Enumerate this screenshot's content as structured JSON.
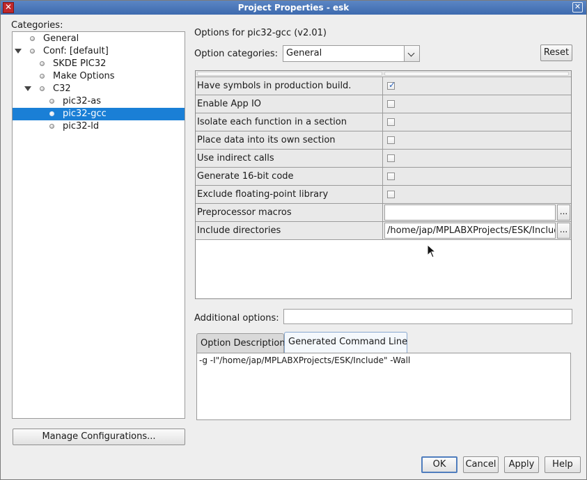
{
  "window": {
    "title": "Project Properties - esk",
    "app_icon_glyph": "✕",
    "close_glyph": "✕"
  },
  "categories": {
    "label": "Categories:",
    "items": [
      {
        "label": "General",
        "level": 0,
        "expanded": false,
        "selected": false
      },
      {
        "label": "Conf: [default]",
        "level": 0,
        "expanded": true,
        "selected": false
      },
      {
        "label": "SKDE PIC32",
        "level": 1,
        "expanded": false,
        "selected": false
      },
      {
        "label": "Make Options",
        "level": 1,
        "expanded": false,
        "selected": false
      },
      {
        "label": "C32",
        "level": 1,
        "expanded": true,
        "selected": false
      },
      {
        "label": "pic32-as",
        "level": 2,
        "expanded": false,
        "selected": false
      },
      {
        "label": "pic32-gcc",
        "level": 2,
        "expanded": false,
        "selected": true
      },
      {
        "label": "pic32-ld",
        "level": 2,
        "expanded": false,
        "selected": false
      }
    ]
  },
  "manage_button": "Manage Configurations...",
  "options": {
    "header": "Options for pic32-gcc (v2.01)",
    "categories_label": "Option categories:",
    "selected_category": "General",
    "reset_button": "Reset",
    "rows": [
      {
        "name": "Have symbols in production build.",
        "type": "checkbox",
        "checked": true
      },
      {
        "name": "Enable App IO",
        "type": "checkbox",
        "checked": false
      },
      {
        "name": "Isolate each function in a section",
        "type": "checkbox",
        "checked": false
      },
      {
        "name": "Place data into its own section",
        "type": "checkbox",
        "checked": false
      },
      {
        "name": "Use indirect calls",
        "type": "checkbox",
        "checked": false
      },
      {
        "name": "Generate 16-bit code",
        "type": "checkbox",
        "checked": false
      },
      {
        "name": "Exclude floating-point library",
        "type": "checkbox",
        "checked": false
      },
      {
        "name": "Preprocessor macros",
        "type": "text",
        "value": ""
      },
      {
        "name": "Include directories",
        "type": "text",
        "value": "/home/jap/MPLABXProjects/ESK/Include"
      }
    ],
    "ellipsis_label": "...",
    "additional_label": "Additional options:",
    "additional_value": ""
  },
  "tabs": {
    "option_description": "Option Description",
    "generated_command_line": "Generated Command Line",
    "active": "generated_command_line"
  },
  "command_line": "-g -I\"/home/jap/MPLABXProjects/ESK/Include\" -Wall",
  "buttons": {
    "ok": "OK",
    "cancel": "Cancel",
    "apply": "Apply",
    "help": "Help"
  },
  "colors": {
    "selection": "#1a7fd6",
    "titlebar": "#4a77b9",
    "checkmark": "#2b62b8"
  }
}
